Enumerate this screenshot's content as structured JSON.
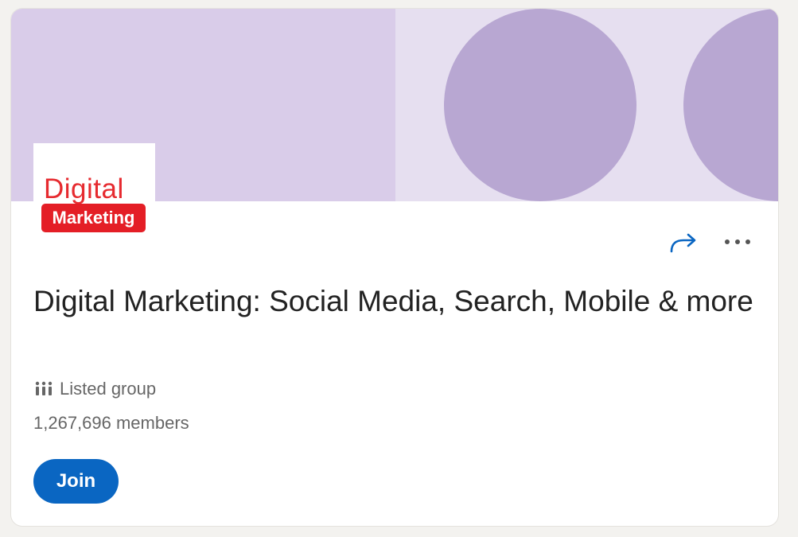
{
  "logo": {
    "word": "Digital",
    "badge": "Marketing"
  },
  "actions": {
    "share_icon": "share-arrow-icon",
    "more_icon": "more-horizontal-icon"
  },
  "group": {
    "title": "Digital Marketing: Social Media, Search, Mobile & more",
    "visibility_icon": "group-people-icon",
    "visibility": "Listed group",
    "members": "1,267,696 members",
    "join_label": "Join"
  },
  "colors": {
    "banner": "#d9cce9",
    "banner_circles": "#b8a7d2",
    "primary": "#0a66c2",
    "logo_red": "#e41e26"
  }
}
